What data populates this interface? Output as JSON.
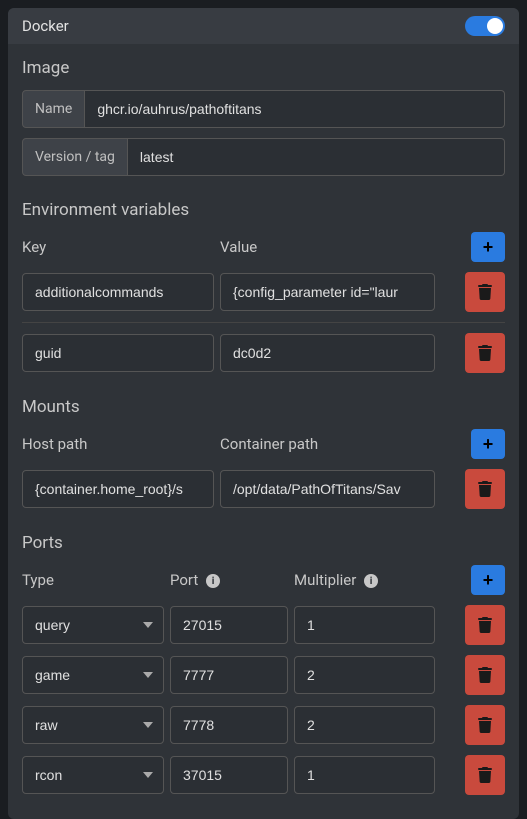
{
  "header": {
    "title": "Docker",
    "enabled": true
  },
  "image": {
    "section_title": "Image",
    "name_label": "Name",
    "name_value": "ghcr.io/auhrus/pathoftitans",
    "version_label": "Version / tag",
    "version_value": "latest"
  },
  "env": {
    "section_title": "Environment variables",
    "key_label": "Key",
    "value_label": "Value",
    "rows": [
      {
        "key": "additionalcommands",
        "value": "{config_parameter id=\"laur"
      },
      {
        "key": "guid",
        "value": "dc0d2"
      }
    ]
  },
  "mounts": {
    "section_title": "Mounts",
    "host_label": "Host path",
    "container_label": "Container path",
    "rows": [
      {
        "host": "{container.home_root}/s",
        "container": "/opt/data/PathOfTitans/Sav"
      }
    ]
  },
  "ports": {
    "section_title": "Ports",
    "type_label": "Type",
    "port_label": "Port",
    "mult_label": "Multiplier",
    "type_options": [
      "query",
      "game",
      "raw",
      "rcon"
    ],
    "rows": [
      {
        "type": "query",
        "port": "27015",
        "mult": "1"
      },
      {
        "type": "game",
        "port": "7777",
        "mult": "2"
      },
      {
        "type": "raw",
        "port": "7778",
        "mult": "2"
      },
      {
        "type": "rcon",
        "port": "37015",
        "mult": "1"
      }
    ]
  },
  "icons": {
    "plus": "+",
    "info": "i"
  }
}
